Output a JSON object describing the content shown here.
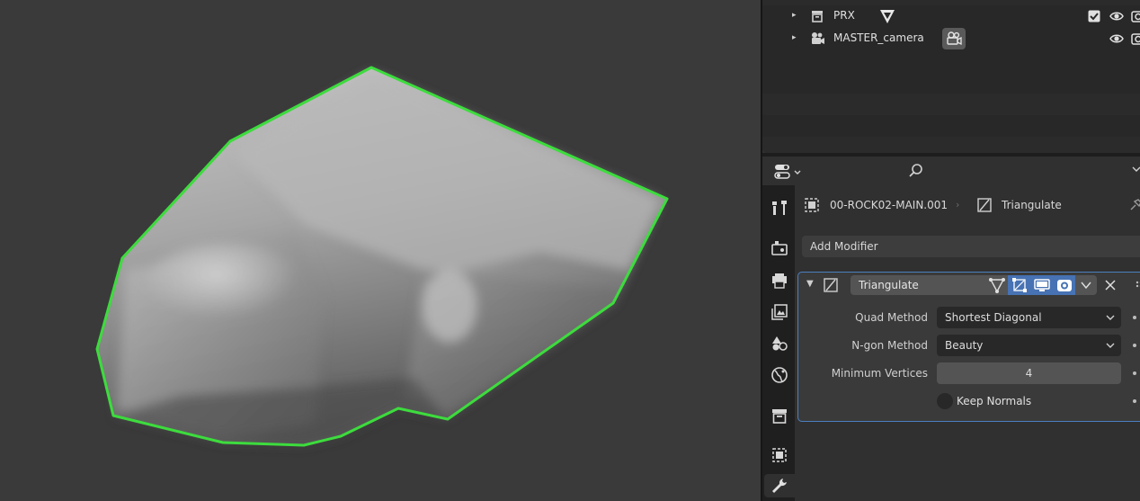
{
  "outliner": {
    "rows": [
      {
        "name": "PRX",
        "expand": "▸",
        "object_icon": "collection-icon",
        "data_icon": "mesh-data-icon",
        "checked": true
      },
      {
        "name": "MASTER_camera",
        "expand": "▸",
        "object_icon": "camera-object-icon",
        "data_icon": "camera-data-icon",
        "checked": false
      }
    ]
  },
  "properties": {
    "tabs": [
      "tool-tab",
      "render-tab",
      "output-tab",
      "view-layer-tab",
      "scene-tab",
      "world-tab",
      "collection-tab",
      "object-tab",
      "modifier-tab"
    ],
    "active_tab": "modifier-tab",
    "breadcrumb": {
      "object": "00-ROCK02-MAIN.001",
      "modifier": "Triangulate"
    },
    "add_modifier_label": "Add Modifier",
    "modifier": {
      "name": "Triangulate",
      "expanded": true,
      "quad_method": {
        "label": "Quad Method",
        "value": "Shortest Diagonal"
      },
      "ngon_method": {
        "label": "N-gon Method",
        "value": "Beauty"
      },
      "min_vertices": {
        "label": "Minimum Vertices",
        "value": "4"
      },
      "keep_normals": {
        "label": "Keep Normals",
        "checked": false
      }
    }
  },
  "viewport": {
    "selection_outline_color": "#3ddc3d"
  }
}
